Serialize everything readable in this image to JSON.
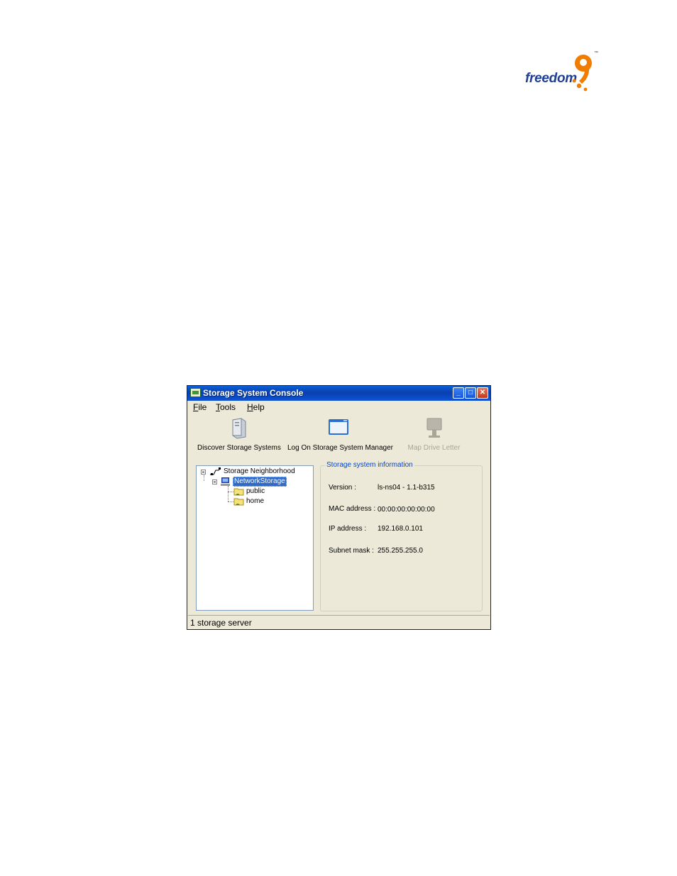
{
  "logo": {
    "word": "freedom",
    "tm": "™"
  },
  "window": {
    "title": "Storage System Console",
    "menu": [
      {
        "underline": "F",
        "rest": "ile"
      },
      {
        "underline": "T",
        "rest": "ools"
      },
      {
        "underline": "H",
        "rest": "elp"
      }
    ],
    "toolbar": {
      "discover": "Discover Storage Systems",
      "logon": "Log On Storage System Manager",
      "map": "Map Drive Letter"
    },
    "tree": {
      "root": "Storage Neighborhood",
      "server": "NetworkStorage",
      "shares": [
        "public",
        "home"
      ]
    },
    "info": {
      "legend": "Storage system information",
      "version_label": "Version :",
      "version_value": "ls-ns04 - 1.1-b315",
      "mac_label": "MAC address :",
      "mac_value": "00:00:00:00:00:00",
      "ip_label": "IP address :",
      "ip_value": "192.168.0.101",
      "subnet_label": "Subnet mask :",
      "subnet_value": "255.255.255.0"
    },
    "status": "1 storage server"
  }
}
